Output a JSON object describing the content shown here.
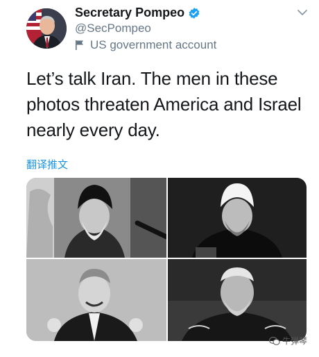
{
  "author": {
    "display_name": "Secretary Pompeo",
    "handle": "@SecPompeo",
    "account_label": "US government account",
    "verified_icon": "verified-badge-icon",
    "verified_color": "#1da1f2"
  },
  "tweet": {
    "text": "Let’s talk Iran. The men in these photos threaten America and Israel nearly every day.",
    "translate_label": "翻译推文"
  },
  "watermark": {
    "text": "牛弹琴"
  },
  "colors": {
    "text": "#14171a",
    "secondary": "#657786",
    "link": "#1b95e0"
  }
}
